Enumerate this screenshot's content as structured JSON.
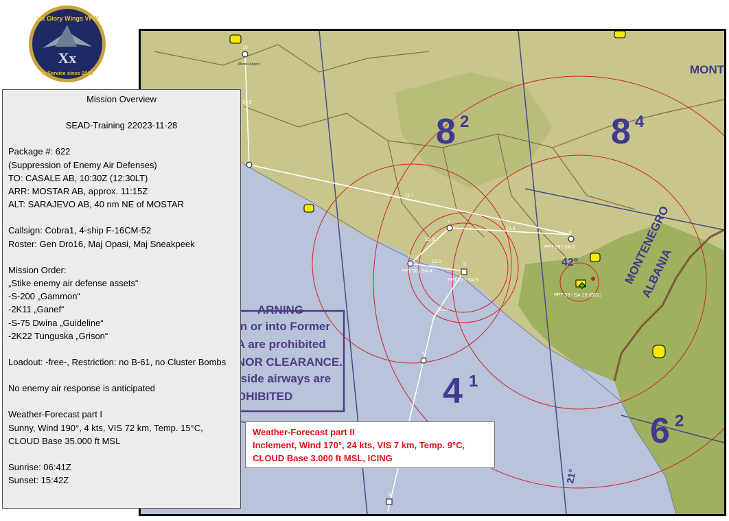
{
  "logo": {
    "text_top": "1st Glory Wings VFW",
    "text_center": "Xx",
    "text_bottom": "In Service since 2003"
  },
  "overview": {
    "title": "Mission Overview",
    "subtitle": "SEAD-Training 22023-11-28",
    "package": "Package #: 622",
    "package_desc": "(Suppression of Enemy Air Defenses)",
    "to": "TO: CASALE AB, 10:30Z (12:30LT)",
    "arr": "ARR: MOSTAR AB, approx. 11:15Z",
    "alt": "ALT: SARAJEVO AB, 40 nm NE of MOSTAR",
    "callsign": "Callsign: Cobra1, 4-ship F-16CM-52",
    "roster": "Roster: Gen Dro16, Maj Opasi, Maj Sneakpeek",
    "order_title": "Mission Order:",
    "order_items": [
      "„Stike enemy air defense assets“",
      "-S-200 „Gammon“",
      "-2K11 „Ganef“",
      "-S-75 Dwina „Guideline“",
      "-2K22 Tunguska „Grison“"
    ],
    "loadout": "Loadout: -free-, Restriction: no B-61, no Cluster Bombs",
    "air_response": "No enemy air response is anticipated",
    "wx1_title": "Weather-Forecast part I",
    "wx1_text": "Sunny, Wind 190°, 4 kts, VIS 72 km, Temp. 15°C, CLOUD Base 35.000 ft MSL",
    "sunrise": "Sunrise: 06:41Z",
    "sunset": "Sunset: 15:42Z"
  },
  "weather2": {
    "title": "Weather-Forecast part II",
    "line1": "Inclement, Wind 170°, 24 kts, VIS 7 km, Temp. 9°C,",
    "line2": "CLOUD Base 3.000 ft MSL, ICING"
  },
  "map": {
    "grid_labels": [
      {
        "main": "8",
        "sup": "2"
      },
      {
        "main": "8",
        "sup": "4"
      },
      {
        "main": "4",
        "sup": "1"
      },
      {
        "main": "6",
        "sup": "2"
      }
    ],
    "country_labels": [
      "MONTENEGRO",
      "ALBANIA",
      "MONTE"
    ],
    "lat_label": "42°",
    "meridian_label": "21°",
    "warning_lines": [
      "ARNING",
      "in or into Former",
      "A are prohibited",
      "NOR CLEARANCE.",
      "tside airways are",
      "OHIBITED"
    ],
    "waypoints": [
      "10",
      "Moster Airport",
      "24.9",
      "73.7",
      "7",
      "23.4",
      "8",
      "12.3",
      "6",
      "12.5",
      "5",
      "22.0",
      "4",
      "3"
    ],
    "waypoint_notes": [
      "PPT 58 / SA-2",
      "PPT 56 / SA-4",
      "PPT 57 / SA-3",
      "PPT 59 / SA-19 (GDL)"
    ],
    "colors": {
      "land": "#c9c68b",
      "sea": "#b9c3d9",
      "route": "#ffffff",
      "rings": "#d2222a",
      "border": "#7e5c3a",
      "grid_label": "#3f3a8e"
    }
  }
}
